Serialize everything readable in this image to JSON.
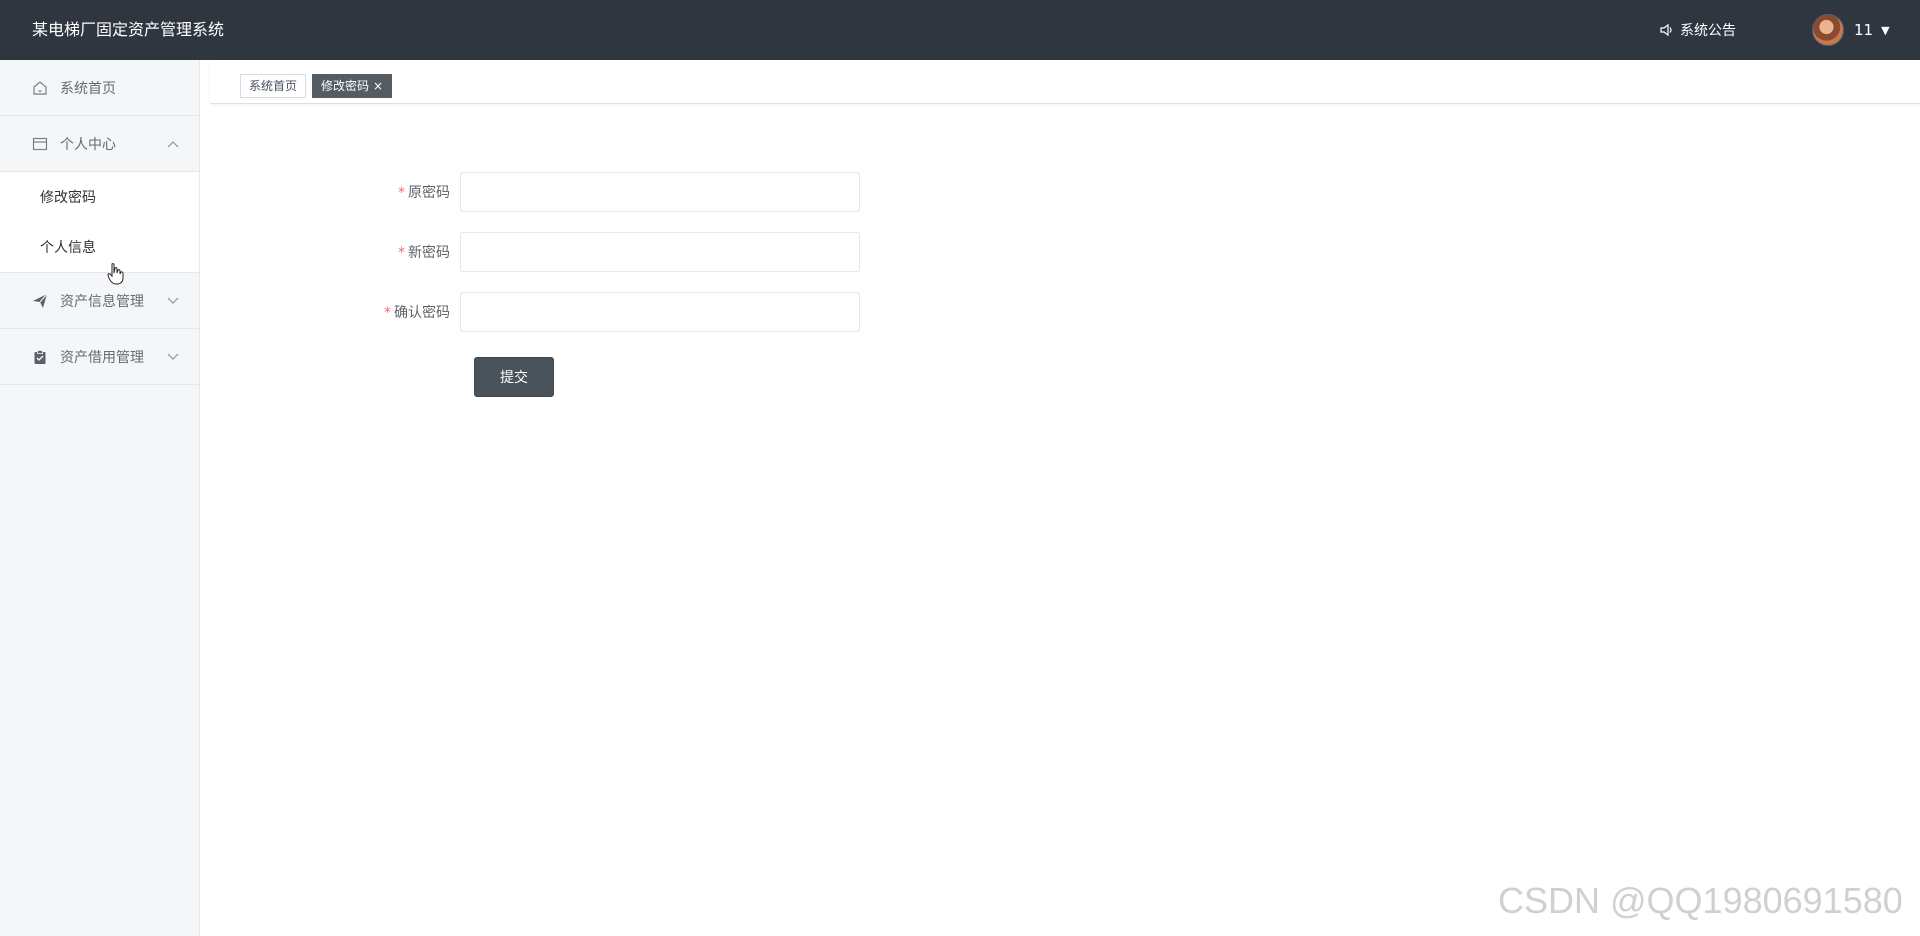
{
  "header": {
    "app_title": "某电梯厂固定资产管理系统",
    "notice_label": "系统公告",
    "username": "11"
  },
  "sidebar": {
    "items": [
      {
        "label": "系统首页",
        "icon": "home-icon"
      },
      {
        "label": "个人中心",
        "icon": "card-icon",
        "expanded": true,
        "children": [
          {
            "label": "修改密码"
          },
          {
            "label": "个人信息"
          }
        ]
      },
      {
        "label": "资产信息管理",
        "icon": "send-icon",
        "expanded": false
      },
      {
        "label": "资产借用管理",
        "icon": "clipboard-icon",
        "expanded": false
      }
    ]
  },
  "tabs": [
    {
      "label": "系统首页",
      "active": false
    },
    {
      "label": "修改密码",
      "active": true,
      "close": "×"
    }
  ],
  "form": {
    "required_mark": "*",
    "fields": [
      {
        "label": "原密码",
        "value": "",
        "placeholder": ""
      },
      {
        "label": "新密码",
        "value": "",
        "placeholder": ""
      },
      {
        "label": "确认密码",
        "value": "",
        "placeholder": ""
      }
    ],
    "submit_label": "提交"
  },
  "watermark": "CSDN @QQ1980691580",
  "colors": {
    "header_bg": "#2f3640",
    "active_tab_bg": "#545c64",
    "submit_bg": "#4a535c",
    "required": "#f56c6c"
  }
}
